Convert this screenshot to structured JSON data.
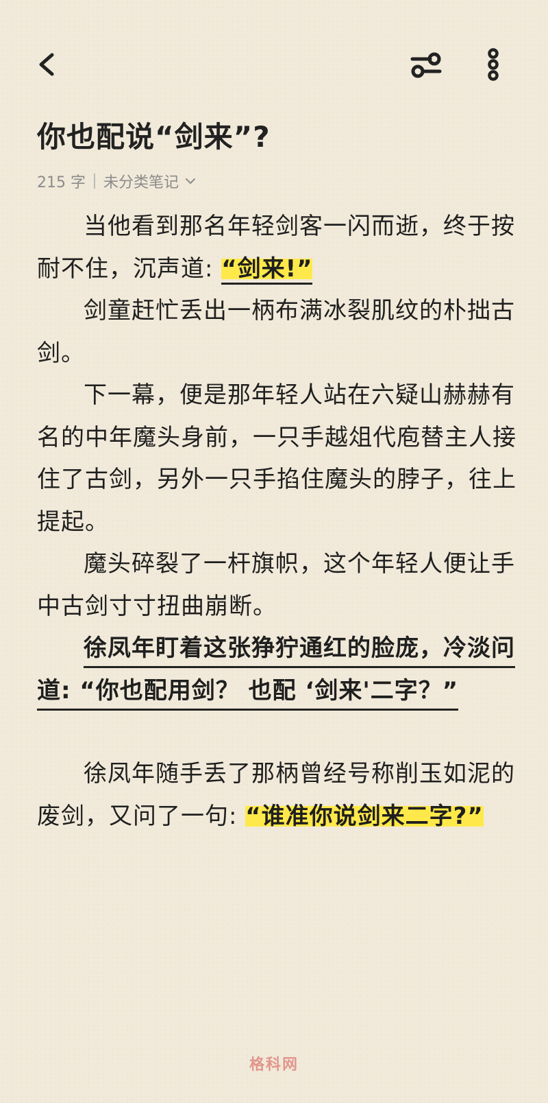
{
  "toolbar": {
    "back_icon": "back-chevron-icon",
    "settings_icon": "sliders-icon",
    "more_icon": "more-vertical-icon"
  },
  "note": {
    "title": "你也配说“剑来”?",
    "meta": {
      "word_count": "215 字",
      "category": "未分类笔记"
    },
    "paragraphs": [
      {
        "text": "当他看到那名年轻剑客一闪而逝，终于按耐不住，沉声道: ",
        "highlight": "“剑来!”"
      },
      {
        "text": "剑童赶忙丢出一柄布满冰裂肌纹的朴拙古剑。"
      },
      {
        "text": "下一幕，便是那年轻人站在六疑山赫赫有名的中年魔头身前，一只手越俎代庖替主人接住了古剑，另外一只手掐住魔头的脖子，往上提起。"
      },
      {
        "text": "魔头碎裂了一杆旗帜，这个年轻人便让手中古剑寸寸扭曲崩断。"
      },
      {
        "underlined": "徐凤年盯着这张狰狞通红的脸庞，冷淡问道: “你也配用剑？ 也配 ‘剑来'二字？”"
      },
      {
        "text": "徐凤年随手丢了那柄曾经号称削玉如泥的废剑，又问了一句: ",
        "highlight": "“谁准你说剑来二字?”"
      }
    ]
  },
  "watermark": "格科网",
  "colors": {
    "background": "#f1eada",
    "highlight": "#ffe94a",
    "text": "#1f1f1f",
    "meta": "#8b8b8b"
  }
}
